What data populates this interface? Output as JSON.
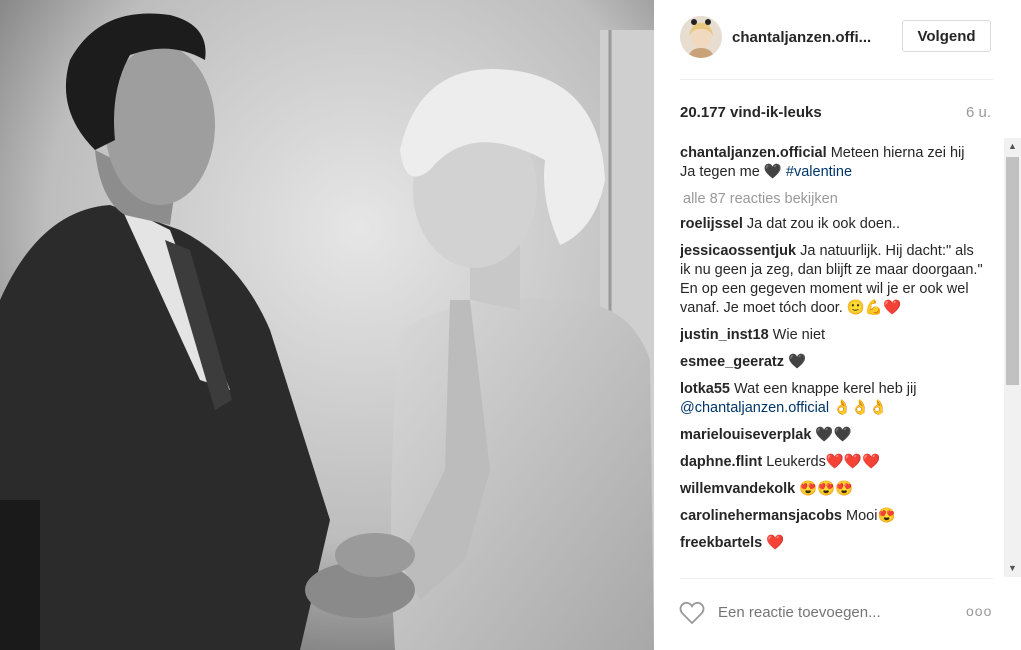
{
  "post": {
    "username": "chantaljanzen.offi...",
    "follow_label": "Volgend",
    "likes": "20.177 vind-ik-leuks",
    "time": "6 u.",
    "caption": {
      "user": "chantaljanzen.official",
      "text": "Meteen hierna zei hij Ja tegen me 🖤 ",
      "hashtag": "#valentine"
    },
    "load_more": "alle 87 reacties bekijken",
    "comments": [
      {
        "user": "roelijssel",
        "text": "Ja dat zou ik ook doen.."
      },
      {
        "user": "jessicaossentjuk",
        "text": "Ja natuurlijk. Hij dacht:\" als ik nu geen ja zeg, dan blijft ze maar doorgaan.\" En op een gegeven moment wil je er ook wel vanaf. Je moet tóch door. 🙂💪❤️"
      },
      {
        "user": "justin_inst18",
        "text": "Wie niet"
      },
      {
        "user": "esmee_geeratz",
        "text": "🖤"
      },
      {
        "user": "lotka55",
        "text": "Wat een knappe kerel heb jij ",
        "mention": "@chantaljanzen.official",
        "suffix": " 👌👌👌"
      },
      {
        "user": "marielouiseverplak",
        "text": "🖤🖤"
      },
      {
        "user": "daphne.flint",
        "text": "Leukerds❤️❤️❤️"
      },
      {
        "user": "willemvandekolk",
        "text": "😍😍😍"
      },
      {
        "user": "carolinehermansjacobs",
        "text": "Mooi😍"
      },
      {
        "user": "freekbartels",
        "text": "❤️"
      }
    ],
    "add_comment_placeholder": "Een reactie toevoegen...",
    "more_options": "ooo"
  },
  "icons": {
    "like": "heart-outline-icon",
    "more": "more-options-icon"
  },
  "colors": {
    "accent_link": "#003569",
    "heart": "#c0272d",
    "muted": "#999999"
  }
}
